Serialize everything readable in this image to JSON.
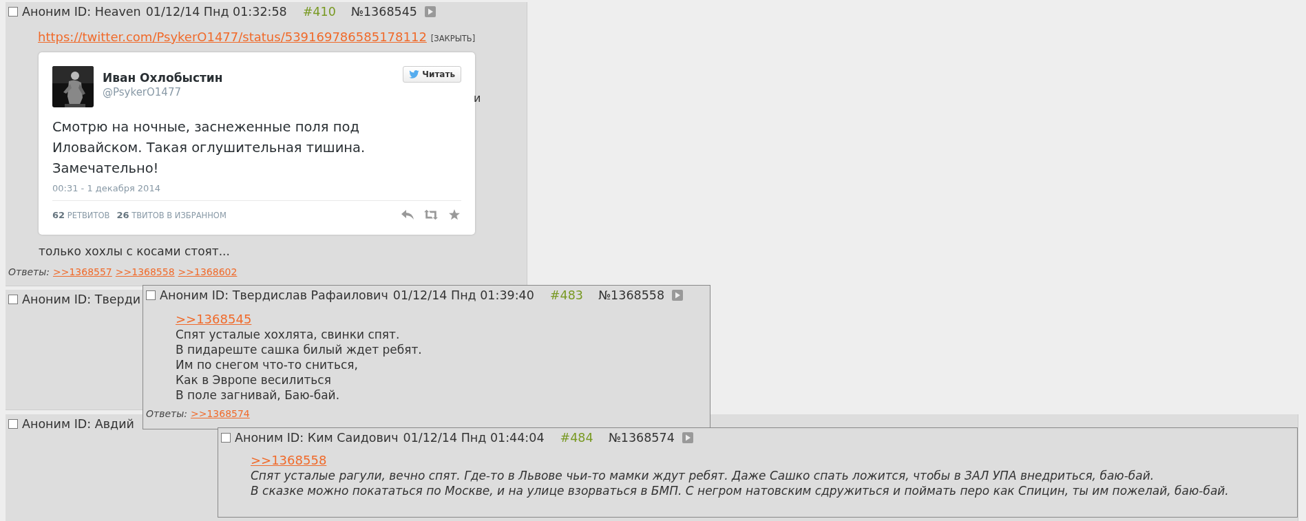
{
  "posts": [
    {
      "checked": false,
      "author": "Аноним ID: Heaven",
      "date": "01/12/14 Пнд 01:32:58",
      "post_number": "#410",
      "post_id": "№1368545",
      "link": "https://twitter.com/PsykerO1477/status/539169786585178112",
      "close": "[ЗАКРЫТЬ]",
      "tweet": {
        "name": "Иван Охлобыстин",
        "handle": "@PsykerO1477",
        "follow": "Читать",
        "text": "Смотрю на ночные, заснеженные поля под Иловайском. Такая оглушительная тишина. Замечательно!",
        "time": "00:31 - 1 декабря 2014",
        "retweets": "62",
        "retweets_label": "РЕТВИТОВ",
        "favorites": "26",
        "favorites_label": "ТВИТОВ В ИЗБРАННОМ"
      },
      "fragment": "и",
      "body": "только хохлы с косами стоят...",
      "replies_label": "Ответы:",
      "replies": [
        ">>1368557",
        ">>1368558",
        ">>1368602"
      ]
    },
    {
      "checked": false,
      "author": "Аноним ID: Тверди"
    },
    {
      "checked": false,
      "author": "Аноним ID: Авдий"
    }
  ],
  "popups": [
    {
      "checked": false,
      "author": "Аноним ID: Твердислав Рафаилович",
      "date": "01/12/14 Пнд 01:39:40",
      "post_number": "#483",
      "post_id": "№1368558",
      "quote": ">>1368545",
      "italic": false,
      "lines": [
        "Спят усталые хохлята, свинки спят.",
        "В пидареште сашка билый ждет ребят.",
        "Им по снегом что-то сниться,",
        "Как в Эвропе весилиться",
        "В поле загнивай, Баю-бай."
      ],
      "replies_label": "Ответы:",
      "replies": [
        ">>1368574"
      ]
    },
    {
      "checked": false,
      "author": "Аноним ID: Ким Саидович",
      "date": "01/12/14 Пнд 01:44:04",
      "post_number": "#484",
      "post_id": "№1368574",
      "quote": ">>1368558",
      "italic": true,
      "lines": [
        "Спят усталые рагули, вечно спят. Где-то в Львове чьи-то мамки ждут ребят. Даже Сашко спать ложится, чтобы в ЗАЛ УПА внедриться, баю-бай.",
        "В сказке можно покататься по Москве, и на улице взорваться в БМП. С негром натовским сдружиться и поймать перо как Спицин, ты им пожелай, баю-бай."
      ]
    }
  ]
}
